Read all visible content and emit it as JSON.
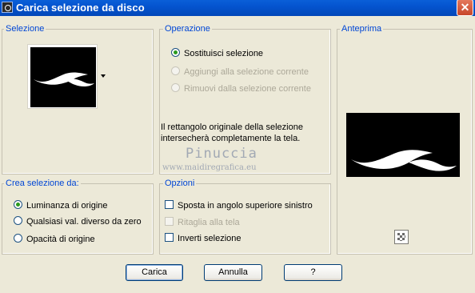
{
  "window": {
    "title": "Carica selezione da disco"
  },
  "groups": {
    "selezione": "Selezione",
    "operazione": "Operazione",
    "anteprima": "Anteprima",
    "crea": "Crea selezione da:",
    "opzioni": "Opzioni"
  },
  "operazione": {
    "options": [
      {
        "label": "Sostituisci selezione",
        "checked": true,
        "enabled": true
      },
      {
        "label": "Aggiungi alla selezione corrente",
        "checked": false,
        "enabled": false
      },
      {
        "label": "Rimuovi dalla selezione corrente",
        "checked": false,
        "enabled": false
      }
    ],
    "note_line1": "Il rettangolo originale della selezione",
    "note_line2": "intersecherà completamente la tela."
  },
  "crea": {
    "options": [
      {
        "label": "Luminanza di origine",
        "checked": true
      },
      {
        "label": "Qualsiasi val. diverso da zero",
        "checked": false
      },
      {
        "label": "Opacità di origine",
        "checked": false
      }
    ]
  },
  "opzioni": {
    "items": [
      {
        "label": "Sposta in angolo superiore sinistro",
        "checked": false,
        "enabled": true
      },
      {
        "label": "Ritaglia alla tela",
        "checked": false,
        "enabled": false
      },
      {
        "label": "Inverti selezione",
        "checked": false,
        "enabled": true
      }
    ]
  },
  "buttons": {
    "carica": "Carica",
    "annulla": "Annulla",
    "help": "?"
  },
  "watermark": {
    "name": "Pinuccia",
    "url": "www.maidiregrafica.eu"
  },
  "icons": {
    "close": "close-icon",
    "app": "app-icon",
    "dropdown": "chevron-down-icon",
    "zoom": "checker-icon"
  }
}
